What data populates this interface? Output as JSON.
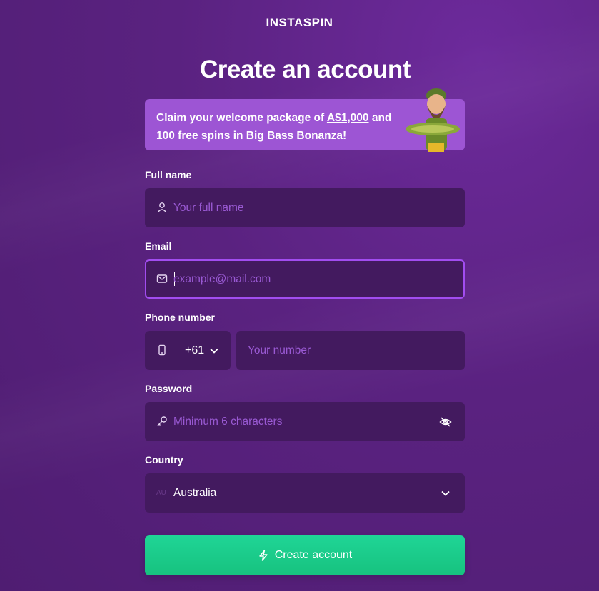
{
  "brand": {
    "logo_text": "INSTASPIN"
  },
  "page": {
    "title": "Create an account"
  },
  "promo": {
    "text_1": "Claim your welcome package of ",
    "amount": "A$1,000",
    "text_2": " and",
    "spins": "100 free spins",
    "text_3": " in Big Bass Bonanza!"
  },
  "form": {
    "full_name": {
      "label": "Full name",
      "placeholder": "Your full name"
    },
    "email": {
      "label": "Email",
      "placeholder": "example@mail.com"
    },
    "phone": {
      "label": "Phone number",
      "code": "+61",
      "placeholder": "Your number"
    },
    "password": {
      "label": "Password",
      "placeholder": "Minimum 6 characters"
    },
    "country": {
      "label": "Country",
      "flag_code": "AU",
      "value": "Australia"
    },
    "submit_label": "Create account"
  },
  "colors": {
    "background": "#5a2280",
    "field_bg": "#431a5f",
    "placeholder": "#9a5ad4",
    "focus_border": "#a24df0",
    "promo_bg": "#9d55d4",
    "cta": "#1fd596"
  },
  "icons": [
    "user-icon",
    "mail-icon",
    "phone-icon",
    "chevron-down-icon",
    "key-icon",
    "eye-off-icon",
    "bolt-icon"
  ]
}
